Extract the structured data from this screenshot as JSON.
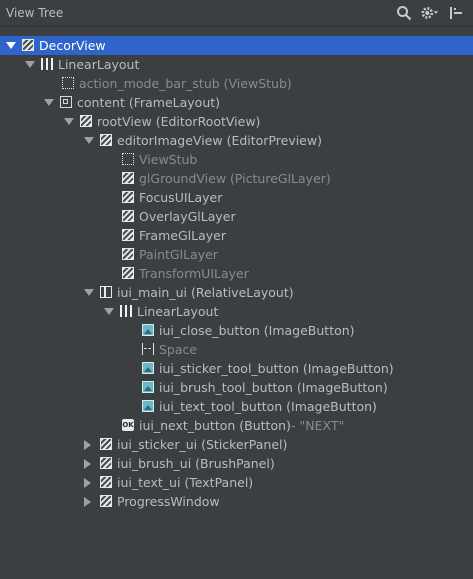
{
  "header": {
    "title": "View Tree"
  },
  "tools": [
    "search-icon",
    "settings-icon",
    "collapse-icon"
  ],
  "nodes": [
    {
      "label": "DecorView",
      "hint": "",
      "icon": "hatch",
      "arrow": "down",
      "selected": true,
      "dim": false
    },
    {
      "label": "LinearLayout",
      "hint": "",
      "icon": "linear",
      "arrow": "down",
      "selected": false,
      "dim": false
    },
    {
      "label": "action_mode_bar_stub (ViewStub)",
      "hint": "",
      "icon": "dotted",
      "arrow": "",
      "selected": false,
      "dim": true
    },
    {
      "label": "content (FrameLayout)",
      "hint": "",
      "icon": "frame",
      "arrow": "down",
      "selected": false,
      "dim": false
    },
    {
      "label": "rootView (EditorRootView)",
      "hint": "",
      "icon": "hatch",
      "arrow": "down",
      "selected": false,
      "dim": false
    },
    {
      "label": "editorImageView (EditorPreview)",
      "hint": "",
      "icon": "hatch",
      "arrow": "down",
      "selected": false,
      "dim": false
    },
    {
      "label": "ViewStub",
      "hint": "",
      "icon": "dotted",
      "arrow": "",
      "selected": false,
      "dim": true
    },
    {
      "label": "glGroundView (PictureGlLayer)",
      "hint": "",
      "icon": "hatch",
      "arrow": "",
      "selected": false,
      "dim": true
    },
    {
      "label": "FocusUILayer",
      "hint": "",
      "icon": "hatch",
      "arrow": "",
      "selected": false,
      "dim": false
    },
    {
      "label": "OverlayGlLayer",
      "hint": "",
      "icon": "hatch",
      "arrow": "",
      "selected": false,
      "dim": false
    },
    {
      "label": "FrameGlLayer",
      "hint": "",
      "icon": "hatch",
      "arrow": "",
      "selected": false,
      "dim": false
    },
    {
      "label": "PaintGlLayer",
      "hint": "",
      "icon": "hatch",
      "arrow": "",
      "selected": false,
      "dim": true
    },
    {
      "label": "TransformUILayer",
      "hint": "",
      "icon": "hatch",
      "arrow": "",
      "selected": false,
      "dim": true
    },
    {
      "label": "iui_main_ui (RelativeLayout)",
      "hint": "",
      "icon": "relative",
      "arrow": "down",
      "selected": false,
      "dim": false
    },
    {
      "label": "LinearLayout",
      "hint": "",
      "icon": "linear",
      "arrow": "down",
      "selected": false,
      "dim": false
    },
    {
      "label": "iui_close_button (ImageButton)",
      "hint": "",
      "icon": "image",
      "arrow": "",
      "selected": false,
      "dim": false
    },
    {
      "label": "Space",
      "hint": "",
      "icon": "space",
      "arrow": "",
      "selected": false,
      "dim": true
    },
    {
      "label": "iui_sticker_tool_button (ImageButton)",
      "hint": "",
      "icon": "image",
      "arrow": "",
      "selected": false,
      "dim": false
    },
    {
      "label": "iui_brush_tool_button (ImageButton)",
      "hint": "",
      "icon": "image",
      "arrow": "",
      "selected": false,
      "dim": false
    },
    {
      "label": "iui_text_tool_button (ImageButton)",
      "hint": "",
      "icon": "image",
      "arrow": "",
      "selected": false,
      "dim": false
    },
    {
      "label": "iui_next_button (Button)",
      "hint": " - \"NEXT\"",
      "icon": "ok",
      "arrow": "",
      "selected": false,
      "dim": false
    },
    {
      "label": "iui_sticker_ui (StickerPanel)",
      "hint": "",
      "icon": "hatch",
      "arrow": "right",
      "selected": false,
      "dim": false
    },
    {
      "label": "iui_brush_ui (BrushPanel)",
      "hint": "",
      "icon": "hatch",
      "arrow": "right",
      "selected": false,
      "dim": false
    },
    {
      "label": "iui_text_ui (TextPanel)",
      "hint": "",
      "icon": "hatch",
      "arrow": "right",
      "selected": false,
      "dim": false
    },
    {
      "label": "ProgressWindow",
      "hint": "",
      "icon": "hatch",
      "arrow": "right",
      "selected": false,
      "dim": false
    }
  ]
}
